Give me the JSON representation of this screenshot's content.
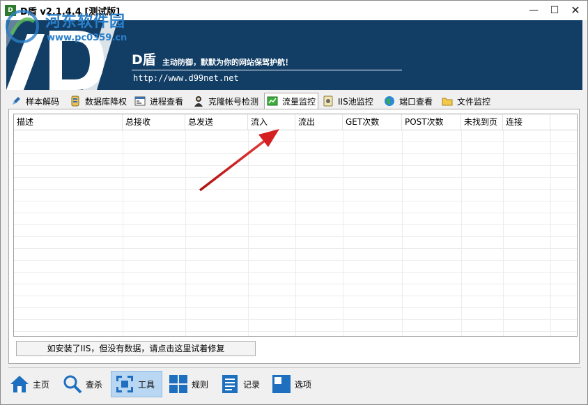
{
  "window": {
    "title": "D盾 v2.1.4.4 [测试版]",
    "icon_text": "D"
  },
  "watermark": {
    "text": "河东软件园",
    "url": "www.pc0359.cn"
  },
  "banner": {
    "name": "D盾",
    "slogan": "主动防御，默默为你的网站保驾护航！",
    "url": "http://www.d99net.net",
    "background_color": "#123e66"
  },
  "tabs": [
    {
      "label": "样本解码",
      "icon": "pen-icon",
      "active": false
    },
    {
      "label": "数据库降权",
      "icon": "database-icon",
      "active": false
    },
    {
      "label": "进程查看",
      "icon": "window-icon",
      "active": false
    },
    {
      "label": "克隆帐号检测",
      "icon": "user-clone-icon",
      "active": false
    },
    {
      "label": "流量监控",
      "icon": "traffic-chart-icon",
      "active": true
    },
    {
      "label": "IIS池监控",
      "icon": "iis-pool-icon",
      "active": false
    },
    {
      "label": "端口查看",
      "icon": "globe-icon",
      "active": false
    },
    {
      "label": "文件监控",
      "icon": "folder-icon",
      "active": false
    }
  ],
  "table": {
    "columns": [
      "描述",
      "总接收",
      "总发送",
      "流入",
      "流出",
      "GET次数",
      "POST次数",
      "未找到页",
      "连接"
    ],
    "rows": []
  },
  "fix_button": {
    "label": "如安装了IIS，但没有数据，请点击这里试着修复"
  },
  "toolbar": [
    {
      "label": "主页",
      "icon": "home-icon",
      "active": false
    },
    {
      "label": "查杀",
      "icon": "search-icon",
      "active": false
    },
    {
      "label": "工具",
      "icon": "tools-icon",
      "active": true
    },
    {
      "label": "规则",
      "icon": "rules-grid-icon",
      "active": false
    },
    {
      "label": "记录",
      "icon": "log-icon",
      "active": false
    },
    {
      "label": "选项",
      "icon": "options-icon",
      "active": false
    }
  ],
  "accent_colors": {
    "active_toolbar_bg": "#b9d7f2",
    "icon_blue": "#1e6fc0"
  }
}
